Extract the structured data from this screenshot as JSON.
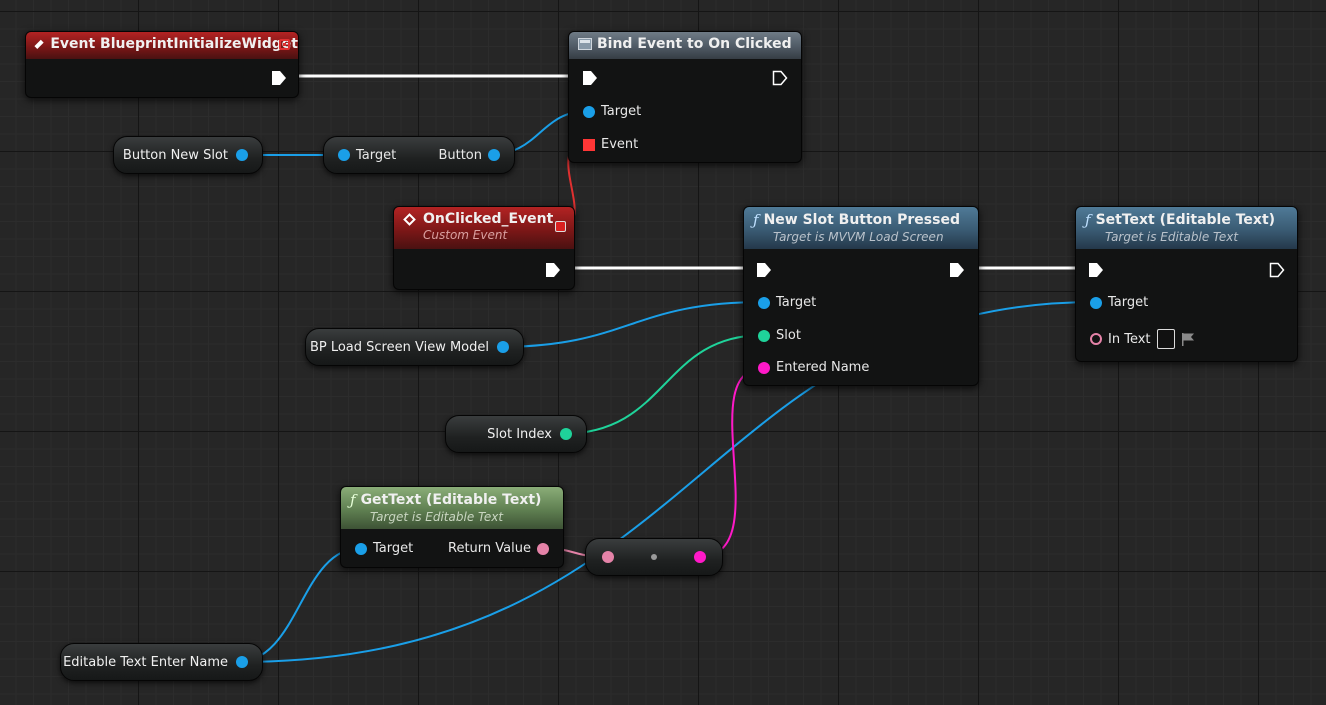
{
  "nodes": {
    "init_event": {
      "title": "Event BlueprintInitializeWidget"
    },
    "bind_event": {
      "title": "Bind Event to On Clicked",
      "pins": {
        "target": "Target",
        "event": "Event"
      }
    },
    "on_clicked": {
      "title": "OnClicked_Event",
      "subtitle": "Custom Event"
    },
    "new_slot": {
      "title": "New Slot Button Pressed",
      "subtitle": "Target is MVVM Load Screen",
      "pins": {
        "target": "Target",
        "slot": "Slot",
        "entered_name": "Entered Name"
      }
    },
    "set_text": {
      "title": "SetText (Editable Text)",
      "subtitle": "Target is Editable Text",
      "pins": {
        "target": "Target",
        "in_text": "In Text"
      }
    },
    "get_text": {
      "title": "GetText (Editable Text)",
      "subtitle": "Target is Editable Text",
      "pins": {
        "target": "Target",
        "return_value": "Return Value"
      }
    },
    "get_button": {
      "pins": {
        "target": "Target",
        "button": "Button"
      }
    }
  },
  "variables": {
    "button_new_slot": "Button New Slot",
    "bp_view_model": "BP Load Screen View Model",
    "slot_index": "Slot Index",
    "editable_text": "Editable Text Enter Name"
  },
  "colors": {
    "exec_wire": "#ffffff",
    "object_wire": "#1a9fe8",
    "int_wire": "#1fd39a",
    "string_wire": "#ff19c8",
    "text_wire": "#e583a8",
    "delegate_wire": "#e03030",
    "event_header": "#9a1d1d",
    "function_header": "#3e6078",
    "pure_header": "#5f7f51"
  }
}
